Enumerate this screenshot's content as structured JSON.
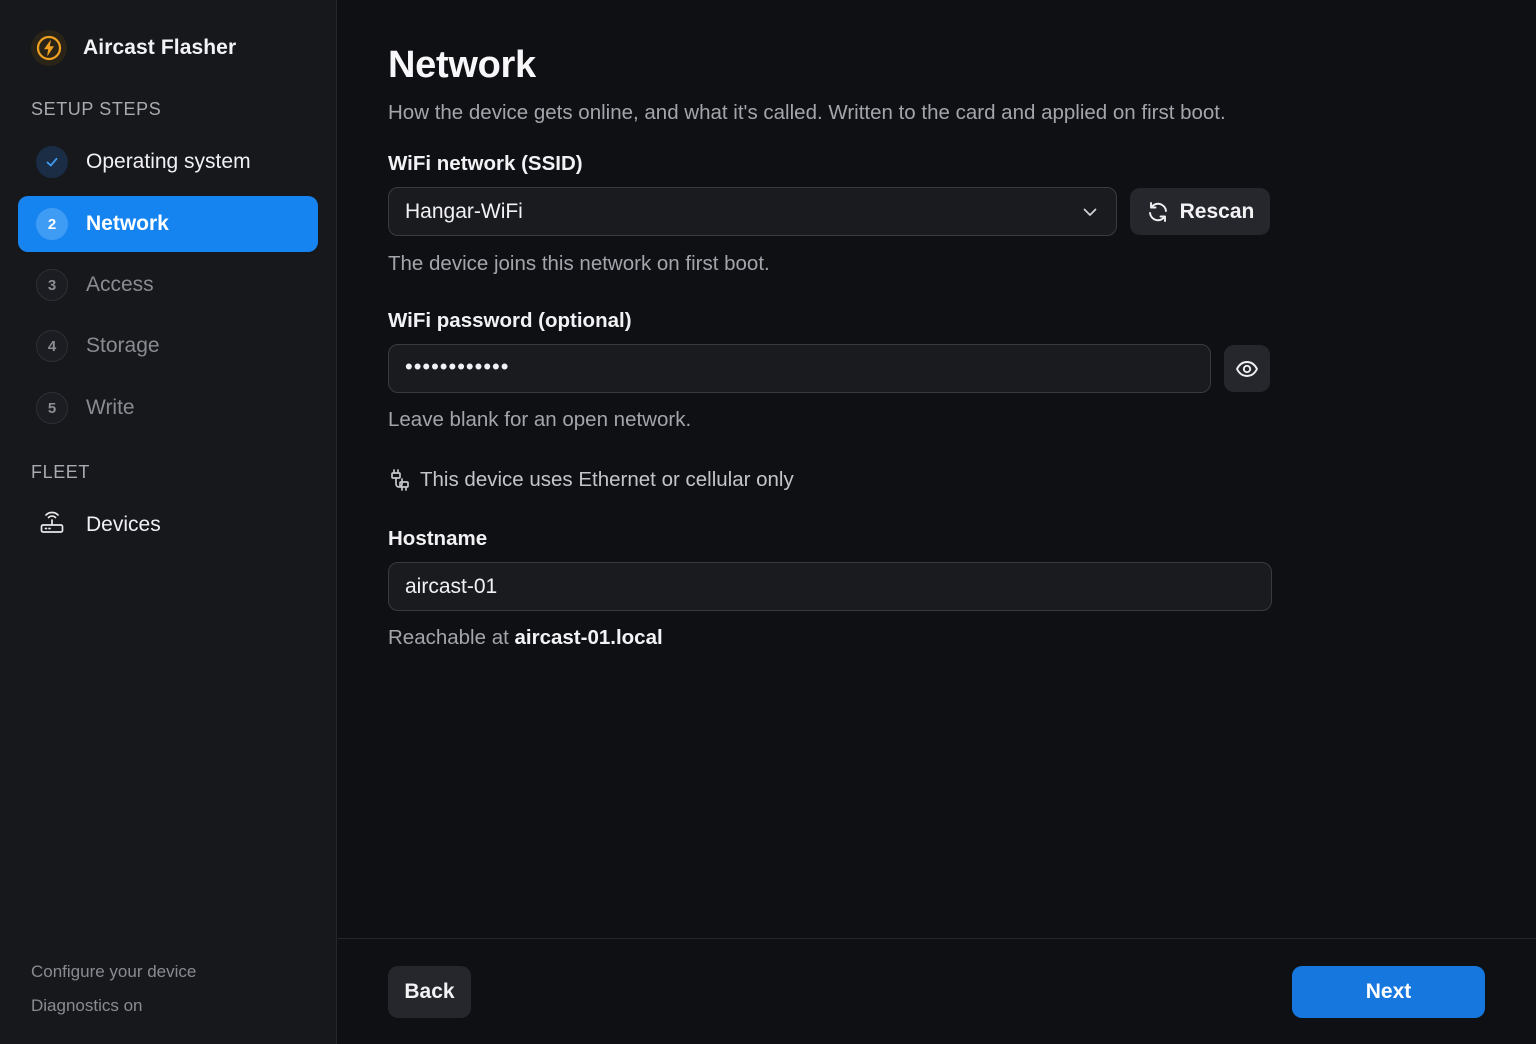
{
  "app": {
    "title": "Aircast Flasher"
  },
  "sidebar": {
    "setup_steps_label": "SETUP STEPS",
    "steps": [
      {
        "number": "",
        "label": "Operating system",
        "state": "done"
      },
      {
        "number": "2",
        "label": "Network",
        "state": "active"
      },
      {
        "number": "3",
        "label": "Access",
        "state": "pending"
      },
      {
        "number": "4",
        "label": "Storage",
        "state": "pending"
      },
      {
        "number": "5",
        "label": "Write",
        "state": "pending"
      }
    ],
    "fleet_label": "FLEET",
    "fleet_items": [
      {
        "label": "Devices",
        "icon": "router-icon"
      }
    ],
    "footer": {
      "line1": "Configure your device",
      "line2": "Diagnostics on"
    }
  },
  "main": {
    "title": "Network",
    "subtitle": "How the device gets online, and what it's called. Written to the card and applied on first boot.",
    "ssid": {
      "label": "WiFi network (SSID)",
      "value": "Hangar-WiFi",
      "help": "The device joins this network on first boot.",
      "rescan_label": "Rescan"
    },
    "password": {
      "label": "WiFi password (optional)",
      "masked_value": "••••••••••••",
      "help": "Leave blank for an open network."
    },
    "ethernet_toggle": {
      "label": "This device uses Ethernet or cellular only",
      "icon": "cable-icon"
    },
    "hostname": {
      "label": "Hostname",
      "value": "aircast-01",
      "help_prefix": "Reachable at",
      "help_host": "aircast-01.local"
    }
  },
  "footer": {
    "back_label": "Back",
    "next_label": "Next"
  },
  "colors": {
    "accent": "#1684f0",
    "next_button": "#1677df",
    "background": "#0f1014",
    "sidebar": "#17181c",
    "brand_logo_ring": "#f0a020"
  }
}
